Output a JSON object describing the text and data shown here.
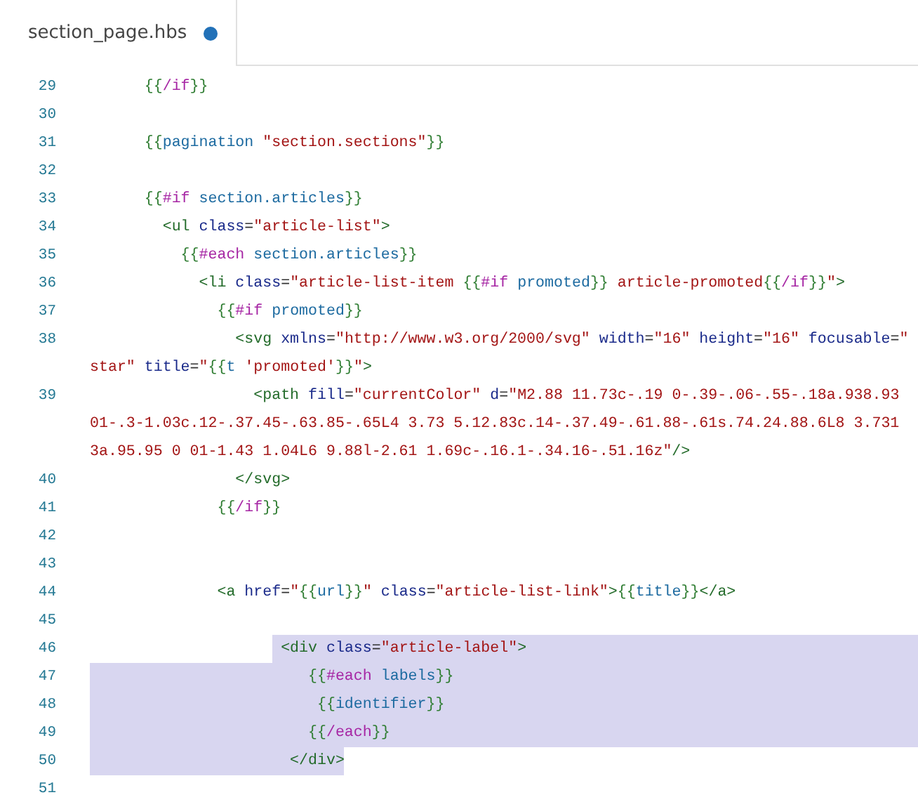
{
  "tab": {
    "title": "section_page.hbs",
    "modified": true
  },
  "lines": [
    {
      "number": "29",
      "rows": [
        {
          "selected": false,
          "segments": [
            {
              "text": "      {{",
              "kind": "brace"
            },
            {
              "text": "/if",
              "kind": "keyword"
            },
            {
              "text": "}}",
              "kind": "brace"
            }
          ]
        }
      ]
    },
    {
      "number": "30"
    },
    {
      "number": "31",
      "rows": [
        {
          "selected": false,
          "segments": [
            {
              "text": "      {{",
              "kind": "brace"
            },
            {
              "text": "pagination",
              "kind": "ident"
            },
            {
              "text": " \"section.sections\"",
              "kind": "string"
            },
            {
              "text": "}}",
              "kind": "brace"
            }
          ]
        }
      ]
    },
    {
      "number": "32"
    },
    {
      "number": "33",
      "rows": [
        {
          "selected": false,
          "segments": [
            {
              "text": "      {{",
              "kind": "brace"
            },
            {
              "text": "#if",
              "kind": "keyword"
            },
            {
              "text": " section.articles",
              "kind": "ident"
            },
            {
              "text": "}}",
              "kind": "brace"
            }
          ]
        }
      ]
    },
    {
      "number": "34",
      "rows": [
        {
          "selected": false,
          "segments": [
            {
              "text": "        <ul",
              "kind": "tag"
            },
            {
              "text": " class",
              "kind": "attr"
            },
            {
              "text": "=",
              "kind": "plain"
            },
            {
              "text": "\"article-list\"",
              "kind": "string"
            },
            {
              "text": ">",
              "kind": "tag"
            }
          ]
        }
      ]
    },
    {
      "number": "35",
      "rows": [
        {
          "selected": false,
          "segments": [
            {
              "text": "          {{",
              "kind": "brace"
            },
            {
              "text": "#each",
              "kind": "keyword"
            },
            {
              "text": " section.articles",
              "kind": "ident"
            },
            {
              "text": "}}",
              "kind": "brace"
            }
          ]
        }
      ]
    },
    {
      "number": "36",
      "rows": [
        {
          "selected": false,
          "segments": [
            {
              "text": "            <li",
              "kind": "tag"
            },
            {
              "text": " class",
              "kind": "attr"
            },
            {
              "text": "=",
              "kind": "plain"
            },
            {
              "text": "\"article-list-item ",
              "kind": "string"
            },
            {
              "text": "{{",
              "kind": "brace"
            },
            {
              "text": "#if",
              "kind": "keyword"
            },
            {
              "text": " promoted",
              "kind": "ident"
            },
            {
              "text": "}}",
              "kind": "brace"
            },
            {
              "text": " article-promoted",
              "kind": "string"
            },
            {
              "text": "{{",
              "kind": "brace"
            },
            {
              "text": "/if",
              "kind": "keyword"
            },
            {
              "text": "}}",
              "kind": "brace"
            },
            {
              "text": "\"",
              "kind": "string"
            },
            {
              "text": ">",
              "kind": "tag"
            }
          ]
        }
      ]
    },
    {
      "number": "37",
      "rows": [
        {
          "selected": false,
          "segments": [
            {
              "text": "              {{",
              "kind": "brace"
            },
            {
              "text": "#if",
              "kind": "keyword"
            },
            {
              "text": " promoted",
              "kind": "ident"
            },
            {
              "text": "}}",
              "kind": "brace"
            }
          ]
        }
      ]
    },
    {
      "number": "38",
      "rows": [
        {
          "selected": false,
          "segments": [
            {
              "text": "                <svg",
              "kind": "tag"
            },
            {
              "text": " xmlns",
              "kind": "attr"
            },
            {
              "text": "=",
              "kind": "plain"
            },
            {
              "text": "\"http://www.w3.org/2000/svg\"",
              "kind": "string"
            },
            {
              "text": " width",
              "kind": "attr"
            },
            {
              "text": "=",
              "kind": "plain"
            },
            {
              "text": "\"16\"",
              "kind": "string"
            },
            {
              "text": " height",
              "kind": "attr"
            },
            {
              "text": "=",
              "kind": "plain"
            },
            {
              "text": "\"16\"",
              "kind": "string"
            },
            {
              "text": " focusable",
              "kind": "attr"
            },
            {
              "text": "=",
              "kind": "plain"
            },
            {
              "text": "\"",
              "kind": "string"
            }
          ]
        },
        {
          "selected": false,
          "segments": [
            {
              "text": "star\"",
              "kind": "string"
            },
            {
              "text": " title",
              "kind": "attr"
            },
            {
              "text": "=",
              "kind": "plain"
            },
            {
              "text": "\"",
              "kind": "string"
            },
            {
              "text": "{{",
              "kind": "brace"
            },
            {
              "text": "t",
              "kind": "ident"
            },
            {
              "text": " 'promoted'",
              "kind": "string"
            },
            {
              "text": "}}",
              "kind": "brace"
            },
            {
              "text": "\"",
              "kind": "string"
            },
            {
              "text": ">",
              "kind": "tag"
            }
          ]
        }
      ]
    },
    {
      "number": "39",
      "rows": [
        {
          "selected": false,
          "segments": [
            {
              "text": "                  <path",
              "kind": "tag"
            },
            {
              "text": " fill",
              "kind": "attr"
            },
            {
              "text": "=",
              "kind": "plain"
            },
            {
              "text": "\"currentColor\"",
              "kind": "string"
            },
            {
              "text": " d",
              "kind": "attr"
            },
            {
              "text": "=",
              "kind": "plain"
            },
            {
              "text": "\"M2.88 11.73c-.19 0-.39-.06-.55-.18a.938.93",
              "kind": "string"
            }
          ]
        },
        {
          "selected": false,
          "segments": [
            {
              "text": "01-.3-1.03c.12-.37.45-.63.85-.65L4 3.73 5.12.83c.14-.37.49-.61.88-.61s.74.24.88.6L8 3.731",
              "kind": "string"
            }
          ]
        },
        {
          "selected": false,
          "segments": [
            {
              "text": "3a.95.95 0 01-1.43 1.04L6 9.88l-2.61 1.69c-.16.1-.34.16-.51.16z\"",
              "kind": "string"
            },
            {
              "text": "/>",
              "kind": "tag"
            }
          ]
        }
      ]
    },
    {
      "number": "40",
      "rows": [
        {
          "selected": false,
          "segments": [
            {
              "text": "                </svg>",
              "kind": "tag"
            }
          ]
        }
      ]
    },
    {
      "number": "41",
      "rows": [
        {
          "selected": false,
          "segments": [
            {
              "text": "              {{",
              "kind": "brace"
            },
            {
              "text": "/if",
              "kind": "keyword"
            },
            {
              "text": "}}",
              "kind": "brace"
            }
          ]
        }
      ]
    },
    {
      "number": "42"
    },
    {
      "number": "43"
    },
    {
      "number": "44",
      "rows": [
        {
          "selected": false,
          "segments": [
            {
              "text": "              <a",
              "kind": "tag"
            },
            {
              "text": " href",
              "kind": "attr"
            },
            {
              "text": "=",
              "kind": "plain"
            },
            {
              "text": "\"",
              "kind": "string"
            },
            {
              "text": "{{",
              "kind": "brace"
            },
            {
              "text": "url",
              "kind": "ident"
            },
            {
              "text": "}}",
              "kind": "brace"
            },
            {
              "text": "\"",
              "kind": "string"
            },
            {
              "text": " class",
              "kind": "attr"
            },
            {
              "text": "=",
              "kind": "plain"
            },
            {
              "text": "\"article-list-link\"",
              "kind": "string"
            },
            {
              "text": ">",
              "kind": "tag"
            },
            {
              "text": "{{",
              "kind": "brace"
            },
            {
              "text": "title",
              "kind": "ident"
            },
            {
              "text": "}}",
              "kind": "brace"
            },
            {
              "text": "</a>",
              "kind": "tag"
            }
          ]
        }
      ]
    },
    {
      "number": "45"
    },
    {
      "number": "46",
      "rows": [
        {
          "selected": true,
          "selected_to_edge": true,
          "indent_unselected": true,
          "segments": [
            {
              "text": "                     <div",
              "kind": "tag"
            },
            {
              "text": " class",
              "kind": "attr"
            },
            {
              "text": "=",
              "kind": "plain"
            },
            {
              "text": "\"article-label\"",
              "kind": "string"
            },
            {
              "text": ">",
              "kind": "tag"
            }
          ]
        }
      ]
    },
    {
      "number": "47",
      "rows": [
        {
          "selected": true,
          "selected_to_edge": true,
          "indent_unselected": false,
          "segments": [
            {
              "text": "                        {{",
              "kind": "brace"
            },
            {
              "text": "#each",
              "kind": "keyword"
            },
            {
              "text": " labels",
              "kind": "ident"
            },
            {
              "text": "}}",
              "kind": "brace"
            }
          ]
        }
      ]
    },
    {
      "number": "48",
      "rows": [
        {
          "selected": true,
          "selected_to_edge": true,
          "indent_unselected": false,
          "segments": [
            {
              "text": "                         {{",
              "kind": "brace"
            },
            {
              "text": "identifier",
              "kind": "ident"
            },
            {
              "text": "}}",
              "kind": "brace"
            }
          ]
        }
      ]
    },
    {
      "number": "49",
      "rows": [
        {
          "selected": true,
          "selected_to_edge": true,
          "indent_unselected": false,
          "segments": [
            {
              "text": "                        {{",
              "kind": "brace"
            },
            {
              "text": "/each",
              "kind": "keyword"
            },
            {
              "text": "}}",
              "kind": "brace"
            }
          ]
        }
      ]
    },
    {
      "number": "50",
      "rows": [
        {
          "selected": true,
          "selected_to_edge": false,
          "indent_unselected": false,
          "segments": [
            {
              "text": "                      </div>",
              "kind": "tag"
            }
          ]
        }
      ]
    },
    {
      "number": "51"
    }
  ]
}
